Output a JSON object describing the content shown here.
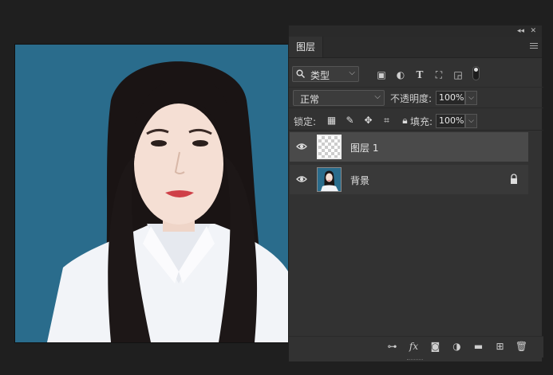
{
  "panel": {
    "tab_label": "图层",
    "filter": {
      "label": "类型"
    },
    "blend_mode": "正常",
    "opacity_label": "不透明度:",
    "opacity_value": "100%",
    "lock_label": "锁定:",
    "fill_label": "填充:",
    "fill_value": "100%"
  },
  "layers": [
    {
      "name": "图层 1",
      "visible": true,
      "selected": true,
      "thumbnail": "transparent"
    },
    {
      "name": "背景",
      "visible": true,
      "selected": false,
      "thumbnail": "portrait",
      "locked": true
    }
  ],
  "icons": {
    "filter_kinds": [
      "pixel-layer-filter-icon",
      "adjustment-layer-filter-icon",
      "type-layer-filter-icon",
      "shape-layer-filter-icon",
      "smart-object-filter-icon"
    ],
    "lock_kinds": [
      "lock-transparent-pixels-icon",
      "lock-image-pixels-icon",
      "lock-position-icon",
      "lock-artboard-icon",
      "lock-all-icon"
    ],
    "bottom": [
      "link-layers-icon",
      "fx-icon",
      "add-mask-icon",
      "new-adjustment-icon",
      "new-group-icon",
      "new-layer-icon",
      "delete-layer-icon"
    ]
  },
  "colors": {
    "photo_background": "#2a6c8c",
    "panel_background": "#323232",
    "selected_layer": "#4a4a4a"
  }
}
